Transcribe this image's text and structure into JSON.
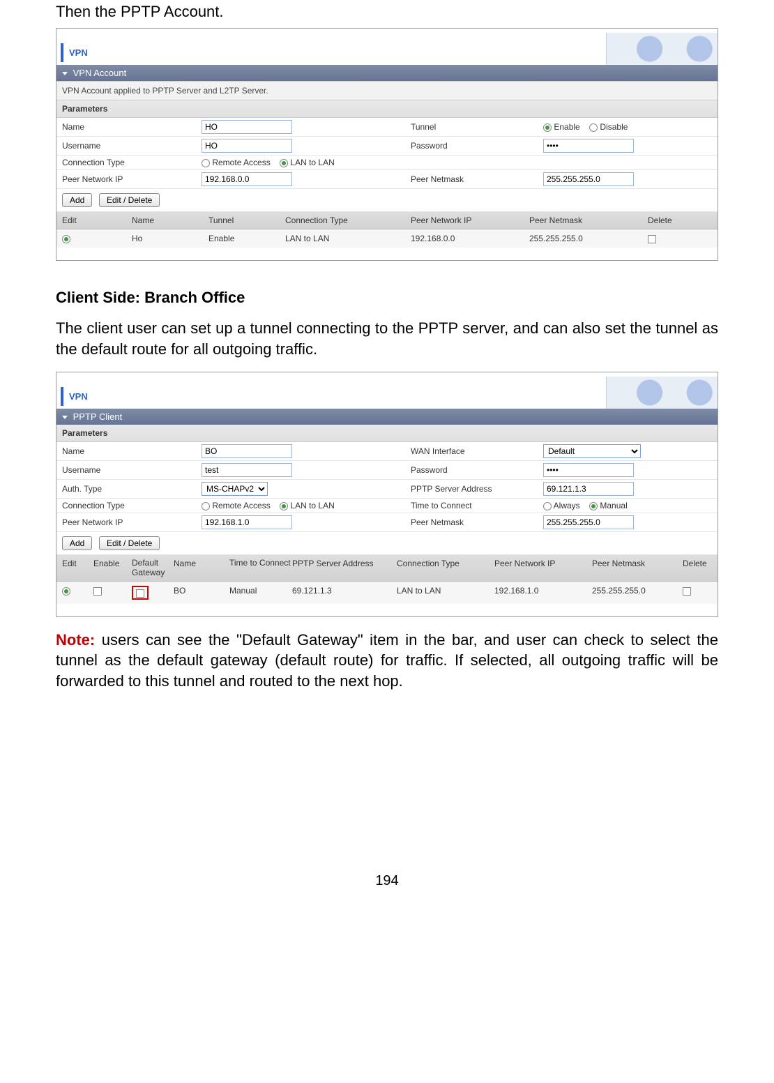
{
  "page_number": "194",
  "text": {
    "intro": "Then the PPTP Account.",
    "client_title": "Client Side: Branch Office",
    "client_para": "The client user can set up a tunnel connecting to the PPTP server, and can also set the tunnel as the default route for all outgoing traffic.",
    "note_label": "Note:",
    "note_body": " users can see the \"Default Gateway\" item in the bar, and user can check to select the tunnel as the default gateway (default route) for traffic. If selected, all outgoing traffic will be forwarded to this tunnel and routed to the next hop."
  },
  "panel1": {
    "tab": "VPN",
    "section": "VPN Account",
    "desc": "VPN Account applied to PPTP Server and L2TP Server.",
    "params_label": "Parameters",
    "labels": {
      "name": "Name",
      "tunnel": "Tunnel",
      "username": "Username",
      "password": "Password",
      "conn_type": "Connection Type",
      "peer_ip": "Peer Network IP",
      "peer_mask": "Peer Netmask",
      "enable": "Enable",
      "disable": "Disable",
      "remote": "Remote Access",
      "l2l": "LAN to LAN"
    },
    "values": {
      "name": "HO",
      "username": "HO",
      "password": "••••",
      "peer_ip": "192.168.0.0",
      "peer_mask": "255.255.255.0"
    },
    "buttons": {
      "add": "Add",
      "editdel": "Edit / Delete"
    },
    "grid_headers": [
      "Edit",
      "Name",
      "Tunnel",
      "Connection Type",
      "Peer Network IP",
      "Peer Netmask",
      "Delete"
    ],
    "grid_row": {
      "name": "Ho",
      "tunnel": "Enable",
      "ctype": "LAN to LAN",
      "ip": "192.168.0.0",
      "mask": "255.255.255.0"
    }
  },
  "panel2": {
    "tab": "VPN",
    "section": "PPTP Client",
    "params_label": "Parameters",
    "labels": {
      "name": "Name",
      "wan": "WAN Interface",
      "username": "Username",
      "password": "Password",
      "auth": "Auth. Type",
      "srv": "PPTP Server Address",
      "conn_type": "Connection Type",
      "ttc": "Time to Connect",
      "peer_ip": "Peer Network IP",
      "peer_mask": "Peer Netmask",
      "remote": "Remote Access",
      "l2l": "LAN to LAN",
      "always": "Always",
      "manual": "Manual"
    },
    "values": {
      "name": "BO",
      "wan": "Default",
      "username": "test",
      "password": "••••",
      "auth": "MS-CHAPv2",
      "srv": "69.121.1.3",
      "peer_ip": "192.168.1.0",
      "peer_mask": "255.255.255.0"
    },
    "buttons": {
      "add": "Add",
      "editdel": "Edit / Delete"
    },
    "grid_headers": [
      "Edit",
      "Enable",
      "Default Gateway",
      "Name",
      "Time to Connect",
      "PPTP Server Address",
      "Connection Type",
      "Peer Network IP",
      "Peer Netmask",
      "Delete"
    ],
    "grid_row": {
      "name": "BO",
      "ttc": "Manual",
      "srv": "69.121.1.3",
      "ctype": "LAN to LAN",
      "ip": "192.168.1.0",
      "mask": "255.255.255.0"
    }
  }
}
